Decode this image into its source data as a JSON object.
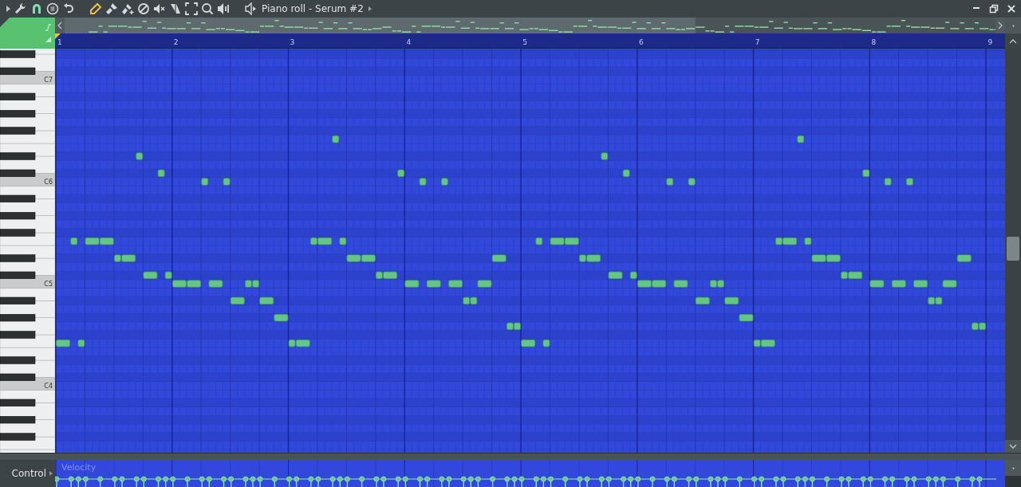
{
  "toolbar": {
    "title": "Piano roll - Serum #2"
  },
  "ruler": {
    "bars": [
      "1",
      "2",
      "3",
      "4",
      "5",
      "6",
      "7",
      "8",
      "9"
    ]
  },
  "keyboard": {
    "labels": [
      "C7",
      "C6",
      "C5",
      "C4"
    ]
  },
  "control": {
    "label": "Control",
    "parameter": "Velocity"
  }
}
